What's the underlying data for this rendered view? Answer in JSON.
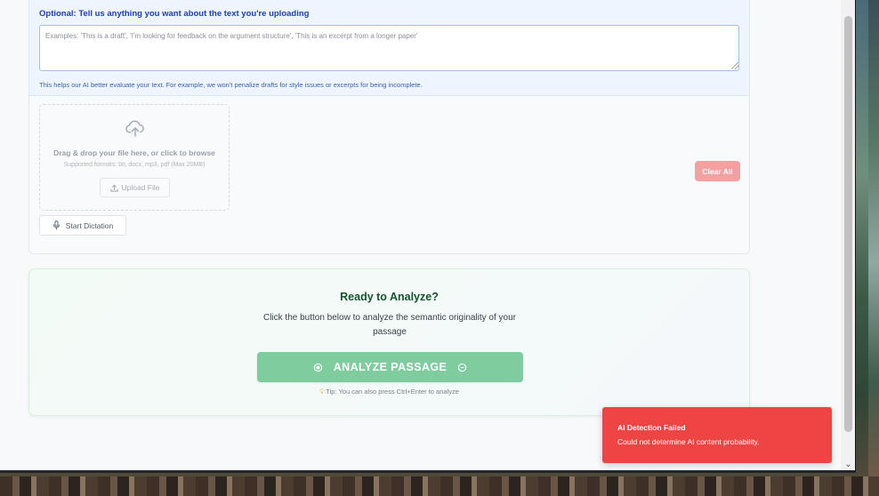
{
  "context": {
    "title": "Optional: Tell us anything you want about the text you're uploading",
    "placeholder": "Examples: 'This is a draft', 'I'm looking for feedback on the argument structure', 'This is an excerpt from a longer paper'",
    "help": "This helps our AI better evaluate your text. For example, we won't penalize drafts for style issues or excerpts for being incomplete."
  },
  "upload": {
    "icon": "cloud-upload-icon",
    "drop_title": "Drag & drop your file here, or click to browse",
    "formats": "Supported formats: txt, docx, mp3, pdf (Max 20MB)",
    "upload_label": "Upload File"
  },
  "dictation": {
    "label": "Start Dictation",
    "icon": "microphone-icon"
  },
  "clear": {
    "label": "Clear All"
  },
  "analyze": {
    "title": "Ready to Analyze?",
    "description": "Click the button below to analyze the semantic originality of your passage",
    "button_label": "ANALYZE PASSAGE",
    "tip": "Tip: You can also press Ctrl+Enter to analyze"
  },
  "toast": {
    "title": "AI Detection Failed",
    "message": "Could not determine AI content probability."
  },
  "colors": {
    "accent_green": "#7fcc9f",
    "title_green": "#14532d",
    "context_blue": "#1e40af",
    "error_red": "#ef4444",
    "clear_button": "#f2a0a0"
  }
}
